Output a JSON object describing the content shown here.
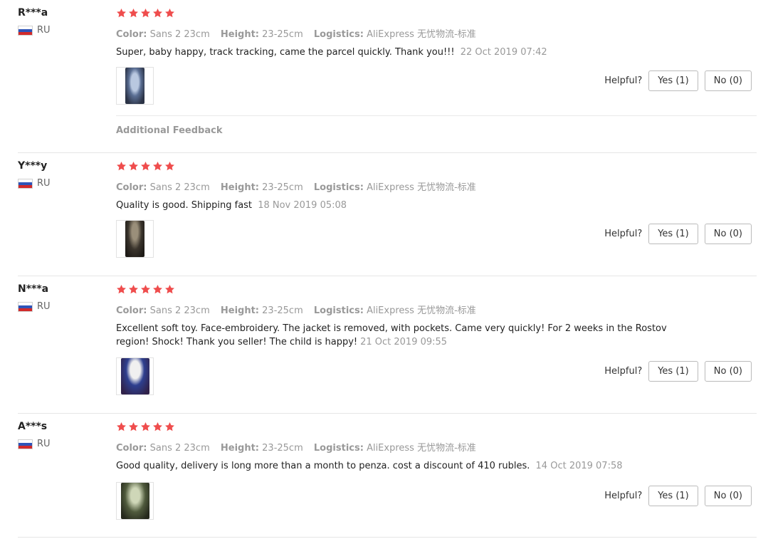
{
  "labels": {
    "helpful": "Helpful?",
    "additional_feedback": "Additional Feedback",
    "color_key": "Color:",
    "height_key": "Height:",
    "logistics_key": "Logistics:"
  },
  "colors": {
    "star": "#ef4d4d",
    "text": "#222222",
    "muted": "#999999"
  },
  "reviews": [
    {
      "user": "R***a",
      "country": "RU",
      "rating": 5,
      "color": "Sans 2 23cm",
      "height": "23-25cm",
      "logistics": "AliExpress 无忧物流-标准",
      "text": "Super, baby happy, track tracking, came the parcel quickly. Thank you!!!",
      "date": "22 Oct 2019 07:42",
      "yes": "Yes (1)",
      "no": "No (0)"
    },
    {
      "user": "Y***y",
      "country": "RU",
      "rating": 5,
      "color": "Sans 2 23cm",
      "height": "23-25cm",
      "logistics": "AliExpress 无忧物流-标准",
      "text": "Quality is good. Shipping fast",
      "date": "18 Nov 2019 05:08",
      "yes": "Yes (1)",
      "no": "No (0)"
    },
    {
      "user": "N***a",
      "country": "RU",
      "rating": 5,
      "color": "Sans 2 23cm",
      "height": "23-25cm",
      "logistics": "AliExpress 无忧物流-标准",
      "text_line1": "Excellent soft toy. Face-embroidery. The jacket is removed, with pockets. Came very quickly! For 2 weeks in the Rostov",
      "text_line2": "region! Shock! Thank you seller! The child is happy!",
      "date": "21 Oct 2019 09:55",
      "yes": "Yes (1)",
      "no": "No (0)"
    },
    {
      "user": "A***s",
      "country": "RU",
      "rating": 5,
      "color": "Sans 2 23cm",
      "height": "23-25cm",
      "logistics": "AliExpress 无忧物流-标准",
      "text": "Good quality, delivery is long more than a month to penza. cost a discount of 410 rubles.",
      "date": "14 Oct 2019 07:58",
      "yes": "Yes (1)",
      "no": "No (0)"
    }
  ]
}
